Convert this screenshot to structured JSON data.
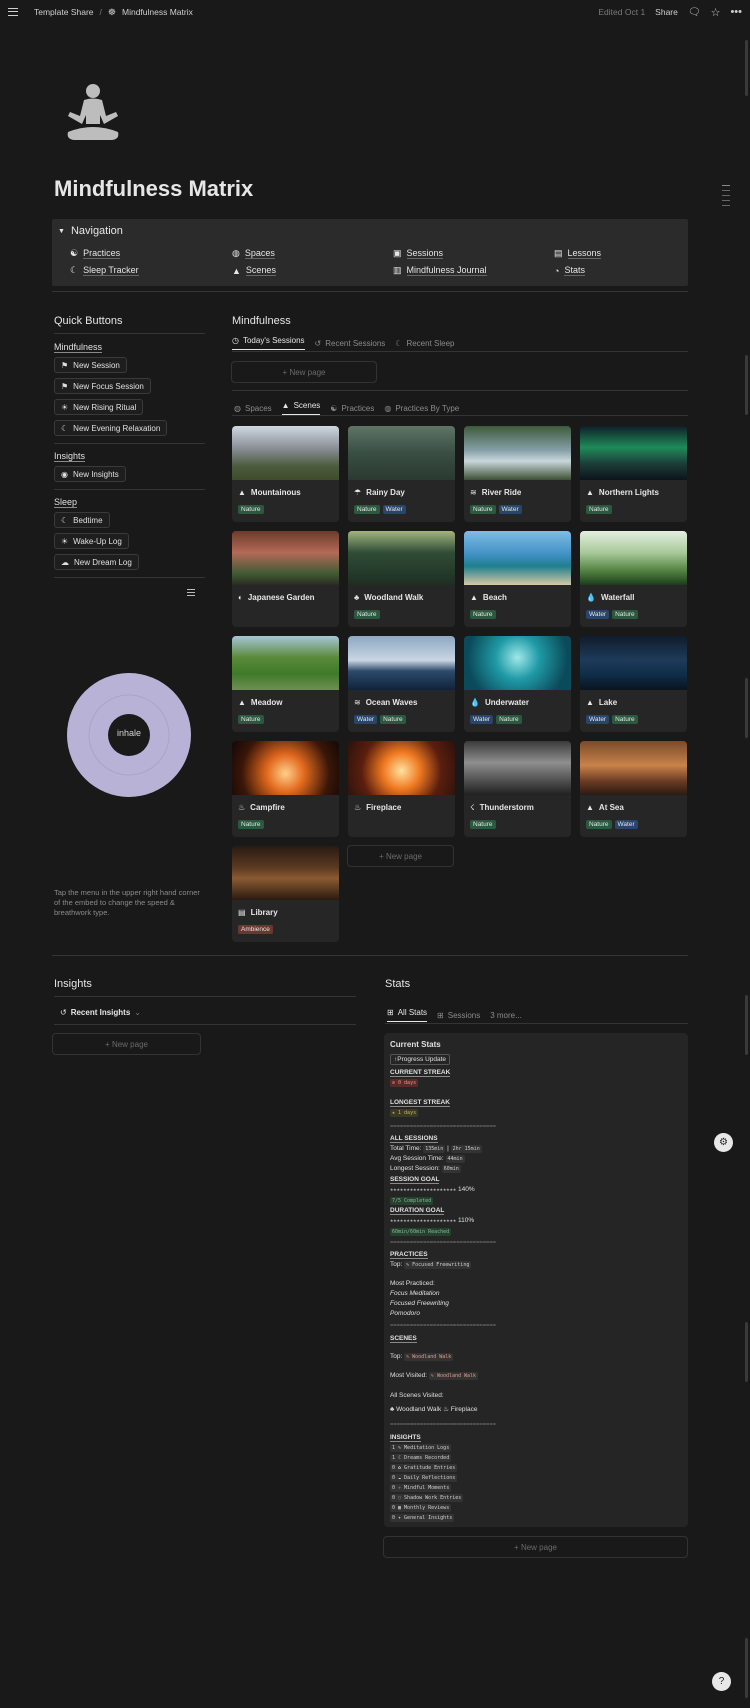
{
  "topbar": {
    "breadcrumb_root": "Template Share",
    "breadcrumb_separator": "/",
    "breadcrumb_page": "Mindfulness Matrix",
    "edited": "Edited Oct 1",
    "share": "Share"
  },
  "page": {
    "title": "Mindfulness Matrix"
  },
  "navigation": {
    "header": "Navigation",
    "items": [
      {
        "label": "Practices",
        "icon": "yin-yang-icon"
      },
      {
        "label": "Spaces",
        "icon": "spaces-icon"
      },
      {
        "label": "Sessions",
        "icon": "sessions-icon"
      },
      {
        "label": "Lessons",
        "icon": "lessons-icon"
      },
      {
        "label": "Sleep Tracker",
        "icon": "sleep-icon"
      },
      {
        "label": "Scenes",
        "icon": "mountain-icon"
      },
      {
        "label": "Mindfulness Journal",
        "icon": "journal-icon"
      },
      {
        "label": "Stats",
        "icon": "pie-icon"
      }
    ]
  },
  "quick_buttons": {
    "title": "Quick Buttons",
    "mindfulness_label": "Mindfulness",
    "mindfulness_buttons": [
      "New Session",
      "New Focus Session",
      "New Rising Ritual",
      "New Evening Relaxation"
    ],
    "insights_label": "Insights",
    "insights_buttons": [
      "New Insights"
    ],
    "sleep_label": "Sleep",
    "sleep_buttons": [
      "Bedtime",
      "Wake-Up Log",
      "New Dream Log"
    ]
  },
  "breath": {
    "center_text": "inhale",
    "caption": "Tap the menu in the upper right hand corner of the embed to change the speed & breathwork type."
  },
  "mindfulness": {
    "title": "Mindfulness",
    "tabs": [
      "Today's Sessions",
      "Recent Sessions",
      "Recent Sleep"
    ],
    "new_page": "New page",
    "view_tabs": [
      "Spaces",
      "Scenes",
      "Practices",
      "Practices By Type"
    ],
    "scenes": [
      {
        "name": "Mountainous",
        "icon": "mountain-icon",
        "tags": [
          "Nature"
        ]
      },
      {
        "name": "Rainy Day",
        "icon": "rain-icon",
        "tags": [
          "Nature",
          "Water"
        ]
      },
      {
        "name": "River Ride",
        "icon": "waves-icon",
        "tags": [
          "Nature",
          "Water"
        ]
      },
      {
        "name": "Northern Lights",
        "icon": "mountain-icon",
        "tags": [
          "Nature"
        ]
      },
      {
        "name": "Japanese Garden",
        "icon": "garden-icon",
        "tags": []
      },
      {
        "name": "Woodland Walk",
        "icon": "tree-icon",
        "tags": [
          "Nature"
        ]
      },
      {
        "name": "Beach",
        "icon": "mountain-icon",
        "tags": [
          "Nature"
        ]
      },
      {
        "name": "Waterfall",
        "icon": "drop-icon",
        "tags": [
          "Water",
          "Nature"
        ]
      },
      {
        "name": "Meadow",
        "icon": "mountain-icon",
        "tags": [
          "Nature"
        ]
      },
      {
        "name": "Ocean Waves",
        "icon": "waves-icon",
        "tags": [
          "Water",
          "Nature"
        ]
      },
      {
        "name": "Underwater",
        "icon": "drop-icon",
        "tags": [
          "Water",
          "Nature"
        ]
      },
      {
        "name": "Lake",
        "icon": "mountain-icon",
        "tags": [
          "Water",
          "Nature"
        ]
      },
      {
        "name": "Campfire",
        "icon": "campfire-icon",
        "tags": [
          "Nature"
        ]
      },
      {
        "name": "Fireplace",
        "icon": "flame-icon",
        "tags": []
      },
      {
        "name": "Thunderstorm",
        "icon": "storm-icon",
        "tags": [
          "Nature"
        ]
      },
      {
        "name": "At Sea",
        "icon": "mountain-icon",
        "tags": [
          "Nature",
          "Water"
        ]
      },
      {
        "name": "Library",
        "icon": "book-icon",
        "tags": [
          "Ambience"
        ]
      }
    ]
  },
  "insights": {
    "title": "Insights",
    "view": "Recent Insights",
    "new_page": "New page"
  },
  "stats": {
    "title": "Stats",
    "tabs": [
      "All Stats",
      "Sessions",
      "3 more..."
    ],
    "box_title": "Current Stats",
    "progress_button": "Progress Update",
    "current_streak_label": "CURRENT STREAK",
    "current_streak_value": "0 days",
    "longest_streak_label": "LONGEST STREAK",
    "longest_streak_value": "1 days",
    "divider": "================================",
    "all_sessions_label": "ALL SESSIONS",
    "total_time_label": "Total Time:",
    "total_time_a": "135min",
    "total_time_b": "2hr 15min",
    "avg_time_label": "Avg Session Time:",
    "avg_time_value": "44min",
    "longest_session_label": "Longest Session:",
    "longest_session_value": "60min",
    "session_goal_label": "SESSION GOAL",
    "session_goal_stars": "★★★★★★★★★★★★★★★★★★★★",
    "session_goal_pct": "140%",
    "session_goal_note": "7/5 Completed",
    "duration_goal_label": "DURATION GOAL",
    "duration_goal_stars": "★★★★★★★★★★★★★★★★★★★★",
    "duration_goal_pct": "110%",
    "duration_goal_note": "60min/60min Reached",
    "practices_label": "PRACTICES",
    "top_label": "Top:",
    "top_practice": "Focused Freewriting",
    "most_practiced_label": "Most Practiced:",
    "most_practiced": [
      "Focus Meditation",
      "Focused Freewriting",
      "Pomodoro"
    ],
    "scenes_label": "SCENES",
    "top_scene": "Woodland Walk",
    "most_visited_label": "Most Visited:",
    "most_visited": "Woodland Walk",
    "all_scenes_label": "All Scenes Visited:",
    "all_scenes": [
      "Woodland Walk",
      "Fireplace"
    ],
    "insights_label": "INSIGHTS",
    "insight_rows": [
      {
        "count": "1",
        "label": "Meditation Logs"
      },
      {
        "count": "1",
        "label": "Dreams Recorded"
      },
      {
        "count": "0",
        "label": "Gratitude Entries"
      },
      {
        "count": "0",
        "label": "Daily Reflections"
      },
      {
        "count": "0",
        "label": "Mindful Moments"
      },
      {
        "count": "0",
        "label": "Shadow Work Entries"
      },
      {
        "count": "0",
        "label": "Monthly Reviews"
      },
      {
        "count": "0",
        "label": "General Insights"
      }
    ],
    "new_page": "New page"
  }
}
